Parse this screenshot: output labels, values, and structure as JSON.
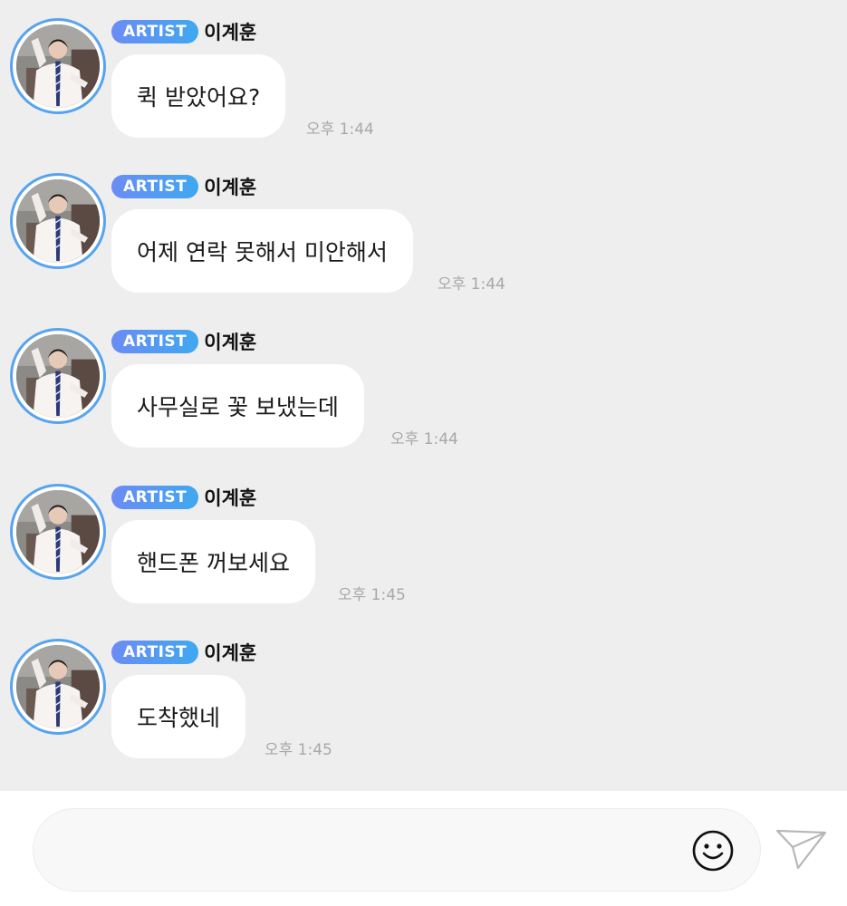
{
  "chat": {
    "messages": [
      {
        "badge": "ARTIST",
        "sender": "이계훈",
        "text": "퀵 받았어요?",
        "time": "오후 1:44"
      },
      {
        "badge": "ARTIST",
        "sender": "이계훈",
        "text": "어제 연락 못해서 미안해서",
        "time": "오후 1:44"
      },
      {
        "badge": "ARTIST",
        "sender": "이계훈",
        "text": "사무실로 꽃 보냈는데",
        "time": "오후 1:44"
      },
      {
        "badge": "ARTIST",
        "sender": "이계훈",
        "text": "핸드폰 꺼보세요",
        "time": "오후 1:45"
      },
      {
        "badge": "ARTIST",
        "sender": "이계훈",
        "text": "도착했네",
        "time": "오후 1:45"
      }
    ]
  },
  "composer": {
    "input_value": "",
    "emoji_icon": "smiley-face-icon",
    "send_icon": "paper-plane-icon"
  },
  "colors": {
    "chat_background": "#eeeeef",
    "badge_gradient_start": "#6b8cf5",
    "badge_gradient_end": "#3fa8ef",
    "avatar_ring": "#57a4ee",
    "bubble": "#ffffff",
    "timestamp": "#a8a8a8"
  }
}
